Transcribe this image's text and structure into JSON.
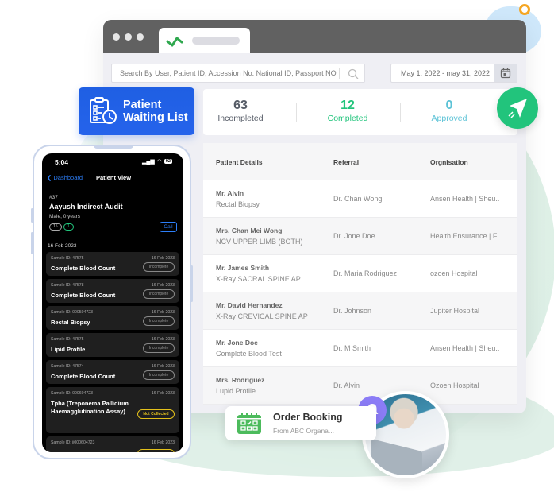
{
  "browser": {
    "search": {
      "placeholder": "Search By User, Patient ID, Accession No. National ID, Passport NO"
    },
    "date_range": "May 1, 2022 - may 31, 2022"
  },
  "waiting_list": {
    "title_line1": "Patient",
    "title_line2": "Waiting List"
  },
  "stats": [
    {
      "value": "63",
      "label": "Incompleted",
      "color": "#555b66"
    },
    {
      "value": "12",
      "label": "Completed",
      "color": "#22c47c"
    },
    {
      "value": "0",
      "label": "Approved",
      "color": "#5bc2d6"
    }
  ],
  "table": {
    "headers": [
      "Patient Details",
      "Referral",
      "Orgnisation"
    ],
    "rows": [
      {
        "name": "Mr. Alvin",
        "test": "Rectal Biopsy",
        "referral": "Dr. Chan Wong",
        "org": "Ansen Health | Sheu.."
      },
      {
        "name": "Mrs. Chan Mei Wong",
        "test": "NCV UPPER LIMB (BOTH)",
        "referral": "Dr. Jone Doe",
        "org": "Health Ensurance | F.."
      },
      {
        "name": "Mr. James Smith",
        "test": "X-Ray SACRAL SPINE AP",
        "referral": "Dr. Maria Rodriguez",
        "org": "ozoen Hospital"
      },
      {
        "name": "Mr. David Hernandez",
        "test": "X-Ray CREVICAL SPINE AP",
        "referral": "Dr. Johnson",
        "org": "Jupiter Hospital"
      },
      {
        "name": "Mr. Jone Doe",
        "test": "Complete Blood Test",
        "referral": "Dr. M Smith",
        "org": "Ansen Health | Sheu.."
      },
      {
        "name": "Mrs. Rodriguez",
        "test": "Lupid Profile",
        "referral": "Dr. Alvin",
        "org": "Ozoen Hospital"
      }
    ]
  },
  "phone": {
    "time": "5:04",
    "battery": "92",
    "back_label": "Dashboard",
    "title": "Patient View",
    "patient_number": "#37",
    "patient_name": "Aayush Indirect Audit",
    "patient_meta": "Male, 0 years",
    "pill_count_gray": "15",
    "pill_count_green": "1",
    "call_label": "Call",
    "date_header": "16 Feb 2023",
    "samples": [
      {
        "id": "Sample ID: 47575",
        "date": "16 Feb 2023",
        "test": "Complete Blood Count",
        "status": "Incomplete"
      },
      {
        "id": "Sample ID: 47578",
        "date": "16 Feb 2023",
        "test": "Complete Blood Count",
        "status": "Incomplete"
      },
      {
        "id": "Sample ID: 000504723",
        "date": "16 Feb 2023",
        "test": "Rectal Biopsy",
        "status": "Incomplete"
      },
      {
        "id": "Sample ID: 47575",
        "date": "16 Feb 2023",
        "test": "Lipid Profile",
        "status": "Incomplete"
      },
      {
        "id": "Sample ID: 47574",
        "date": "16 Feb 2023",
        "test": "Complete Blood Count",
        "status": "Incomplete"
      },
      {
        "id": "Sample ID: 000604723",
        "date": "16 Feb 2023",
        "test": "Tpha (Treponema Pallidium Haemagglutination Assay)",
        "status": "Not Collected"
      },
      {
        "id": "Sample ID: ji000604723",
        "date": "16 Feb 2023",
        "test": "",
        "status": ""
      }
    ]
  },
  "order_booking": {
    "title": "Order Booking",
    "subtitle": "From  ABC Organa..."
  },
  "colors": {
    "primary_blue": "#2563eb",
    "green": "#22c47c",
    "teal": "#5bc2d6",
    "bell_purple": "#8b7cf6",
    "not_collected": "#e3c01b"
  }
}
